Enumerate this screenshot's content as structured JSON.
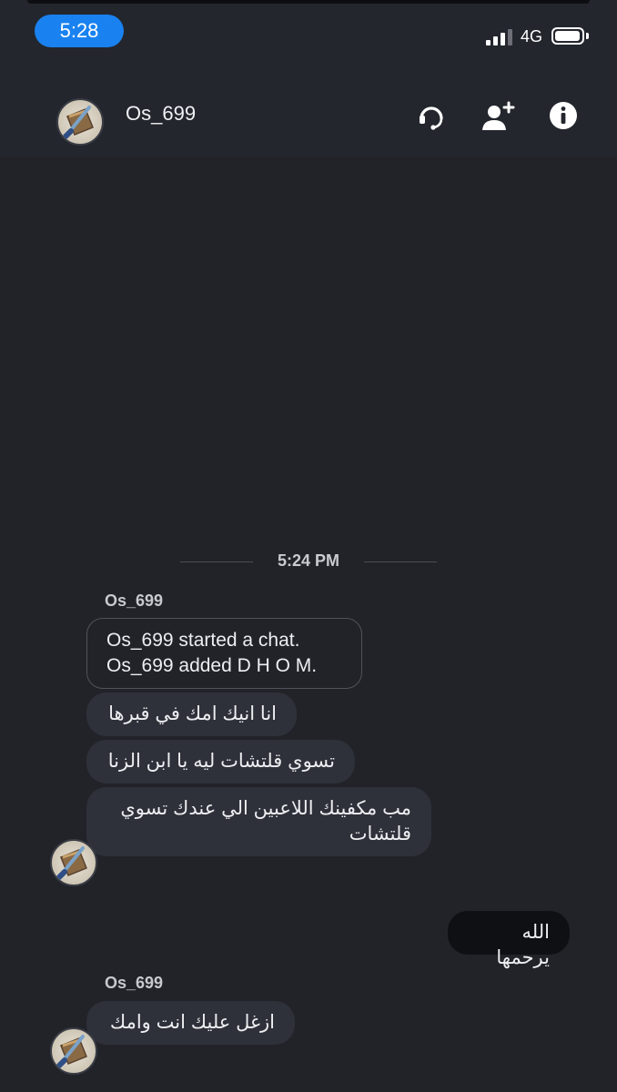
{
  "status_bar": {
    "time": "5:28",
    "network": "4G",
    "battery_level": 0.85,
    "signal_bars": 3
  },
  "header": {
    "contact_name": "Os_699",
    "icons": [
      "support-headset-icon",
      "add-user-icon",
      "info-icon"
    ]
  },
  "chat": {
    "timestamp": "5:24 PM",
    "groups": [
      {
        "sender": "Os_699",
        "system_lines": [
          "Os_699 started a chat.",
          "Os_699 added D H O M."
        ],
        "messages": [
          "انا انيك امك في قبرها",
          "تسوي قلتشات ليه يا ابن الزنا",
          "مب مكفينك اللاعبين الي عندك تسوي قلتشات"
        ]
      },
      {
        "outgoing": "الله يرحمها"
      },
      {
        "sender": "Os_699",
        "messages": [
          "ازغل عليك انت وامك"
        ]
      }
    ]
  },
  "colors": {
    "background": "#212329",
    "header": "#23262d",
    "incoming_bubble": "#2e3139",
    "outgoing_bubble": "#0f1013",
    "accent": "#1a82f0"
  }
}
